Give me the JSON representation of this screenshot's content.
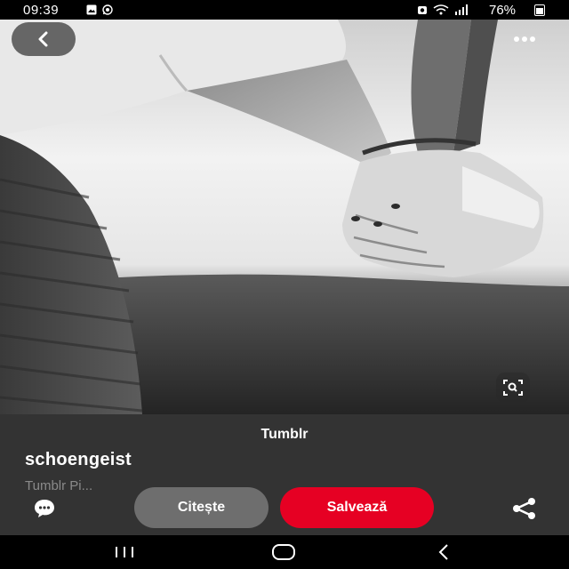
{
  "status_bar": {
    "time": "09:39",
    "battery": "76%",
    "icons": [
      "gallery-icon",
      "whatsapp-icon",
      "battery-saver-icon",
      "wifi-icon",
      "signal-icon",
      "battery-icon"
    ]
  },
  "photo": {
    "description_icon": "photo-of-hands"
  },
  "top_controls": {
    "back_icon": "chevron-left-icon",
    "more_icon": "more-horizontal-icon",
    "lens_icon": "visual-search-icon"
  },
  "pin": {
    "source": "Tumblr",
    "title": "schoengeist",
    "subtitle": "Tumblr Pi..."
  },
  "actions": {
    "comment_icon": "comment-icon",
    "read_label": "Citește",
    "save_label": "Salvează",
    "share_icon": "share-icon"
  },
  "colors": {
    "save_accent": "#e60023",
    "panel_bg": "#333333",
    "read_button_bg": "#6e6e6e"
  },
  "nav_bar": {
    "icons": [
      "recents-icon",
      "home-icon",
      "back-nav-icon"
    ]
  }
}
